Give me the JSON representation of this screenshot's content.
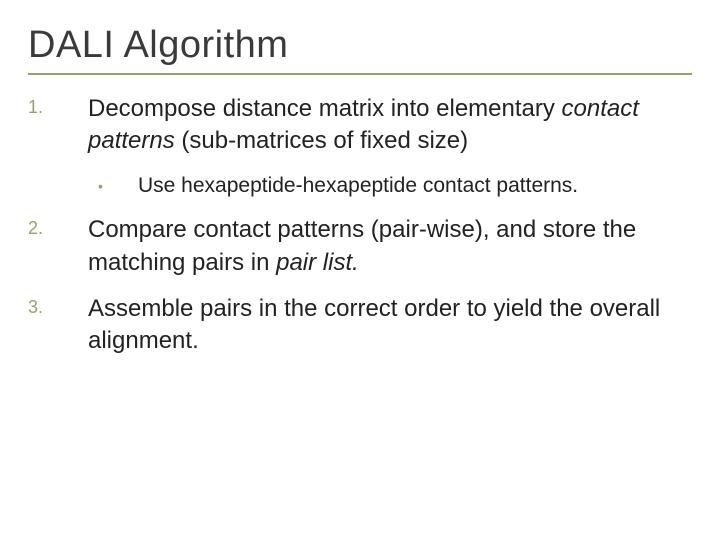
{
  "title": "DALI Algorithm",
  "items": [
    {
      "num": "1.",
      "text_before": "Decompose distance matrix into elementary ",
      "text_italic": "contact patterns",
      "text_after": " (sub-matrices of fixed size)",
      "sub": {
        "bullet": "•",
        "text": "Use hexapeptide-hexapeptide contact patterns."
      }
    },
    {
      "num": "2.",
      "text_before": "Compare contact patterns (pair-wise), and store the matching pairs in ",
      "text_italic": "pair list.",
      "text_after": ""
    },
    {
      "num": "3.",
      "text_before": "Assemble pairs in the correct order to yield the overall alignment.",
      "text_italic": "",
      "text_after": ""
    }
  ]
}
